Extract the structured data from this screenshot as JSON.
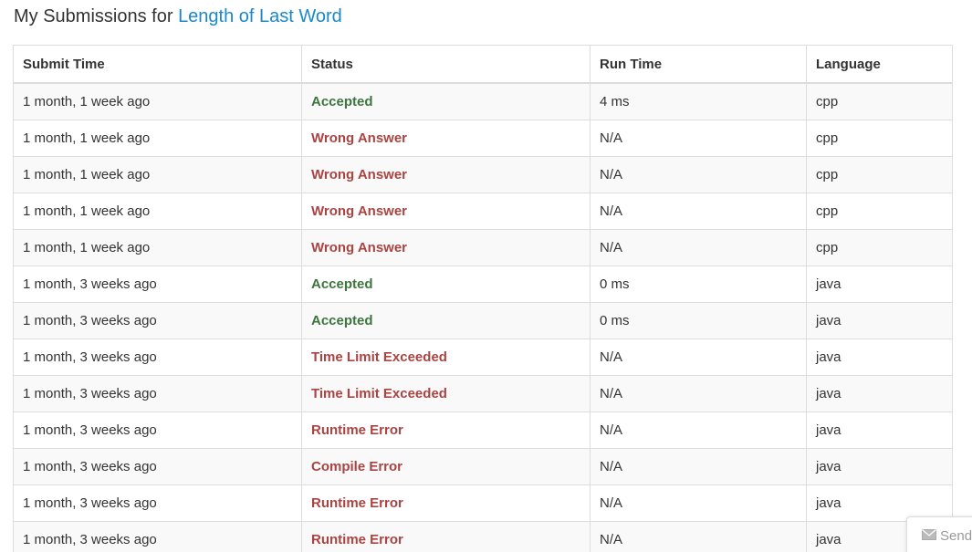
{
  "heading": {
    "prefix": "My Submissions for ",
    "problem": "Length of Last Word"
  },
  "table": {
    "columns": [
      "Submit Time",
      "Status",
      "Run Time",
      "Language"
    ],
    "rows": [
      {
        "time": "1 month, 1 week ago",
        "status": "Accepted",
        "runtime": "4 ms",
        "language": "cpp"
      },
      {
        "time": "1 month, 1 week ago",
        "status": "Wrong Answer",
        "runtime": "N/A",
        "language": "cpp"
      },
      {
        "time": "1 month, 1 week ago",
        "status": "Wrong Answer",
        "runtime": "N/A",
        "language": "cpp"
      },
      {
        "time": "1 month, 1 week ago",
        "status": "Wrong Answer",
        "runtime": "N/A",
        "language": "cpp"
      },
      {
        "time": "1 month, 1 week ago",
        "status": "Wrong Answer",
        "runtime": "N/A",
        "language": "cpp"
      },
      {
        "time": "1 month, 3 weeks ago",
        "status": "Accepted",
        "runtime": "0 ms",
        "language": "java"
      },
      {
        "time": "1 month, 3 weeks ago",
        "status": "Accepted",
        "runtime": "0 ms",
        "language": "java"
      },
      {
        "time": "1 month, 3 weeks ago",
        "status": "Time Limit Exceeded",
        "runtime": "N/A",
        "language": "java"
      },
      {
        "time": "1 month, 3 weeks ago",
        "status": "Time Limit Exceeded",
        "runtime": "N/A",
        "language": "java"
      },
      {
        "time": "1 month, 3 weeks ago",
        "status": "Runtime Error",
        "runtime": "N/A",
        "language": "java"
      },
      {
        "time": "1 month, 3 weeks ago",
        "status": "Compile Error",
        "runtime": "N/A",
        "language": "java"
      },
      {
        "time": "1 month, 3 weeks ago",
        "status": "Runtime Error",
        "runtime": "N/A",
        "language": "java"
      },
      {
        "time": "1 month, 3 weeks ago",
        "status": "Runtime Error",
        "runtime": "N/A",
        "language": "java"
      }
    ]
  },
  "feedback": {
    "label": "Send",
    "icon": "envelope-icon"
  },
  "colors": {
    "link": "#1a88c9",
    "accepted": "#3c763d",
    "error": "#a94442"
  }
}
